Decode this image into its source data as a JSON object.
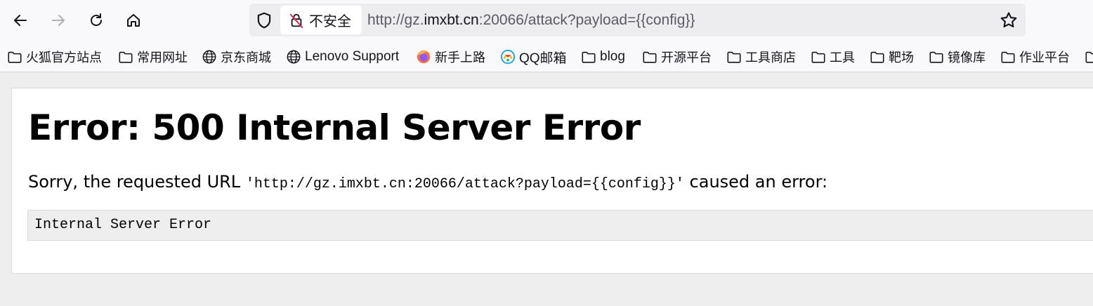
{
  "toolbar": {
    "back_icon": "arrow-left-icon",
    "forward_icon": "arrow-right-icon",
    "reload_icon": "reload-icon",
    "home_icon": "home-icon",
    "security_label": "不安全",
    "url_prefix": "http://gz.",
    "url_host": "imxbt.cn",
    "url_suffix": ":20066/attack?payload={{config}}",
    "bookmark_star_icon": "star-icon"
  },
  "bookmarks": [
    {
      "label": "火狐官方站点",
      "icon": "folder-icon"
    },
    {
      "label": "常用网址",
      "icon": "folder-icon"
    },
    {
      "label": "京东商城",
      "icon": "globe-icon"
    },
    {
      "label": "Lenovo Support",
      "icon": "globe-icon"
    },
    {
      "label": "新手上路",
      "icon": "firefox-icon"
    },
    {
      "label": "QQ邮箱",
      "icon": "qq-mail-icon"
    },
    {
      "label": "blog",
      "icon": "folder-icon"
    },
    {
      "label": "开源平台",
      "icon": "folder-icon"
    },
    {
      "label": "工具商店",
      "icon": "folder-icon"
    },
    {
      "label": "工具",
      "icon": "folder-icon"
    },
    {
      "label": "靶场",
      "icon": "folder-icon"
    },
    {
      "label": "镜像库",
      "icon": "folder-icon"
    },
    {
      "label": "作业平台",
      "icon": "folder-icon"
    }
  ],
  "page": {
    "title": "Error: 500 Internal Server Error",
    "message_before": "Sorry, the requested URL ",
    "message_url": "'http://gz.imxbt.cn:20066/attack?payload={{config}}'",
    "message_after": " caused an error:",
    "error_detail": "Internal Server Error"
  }
}
